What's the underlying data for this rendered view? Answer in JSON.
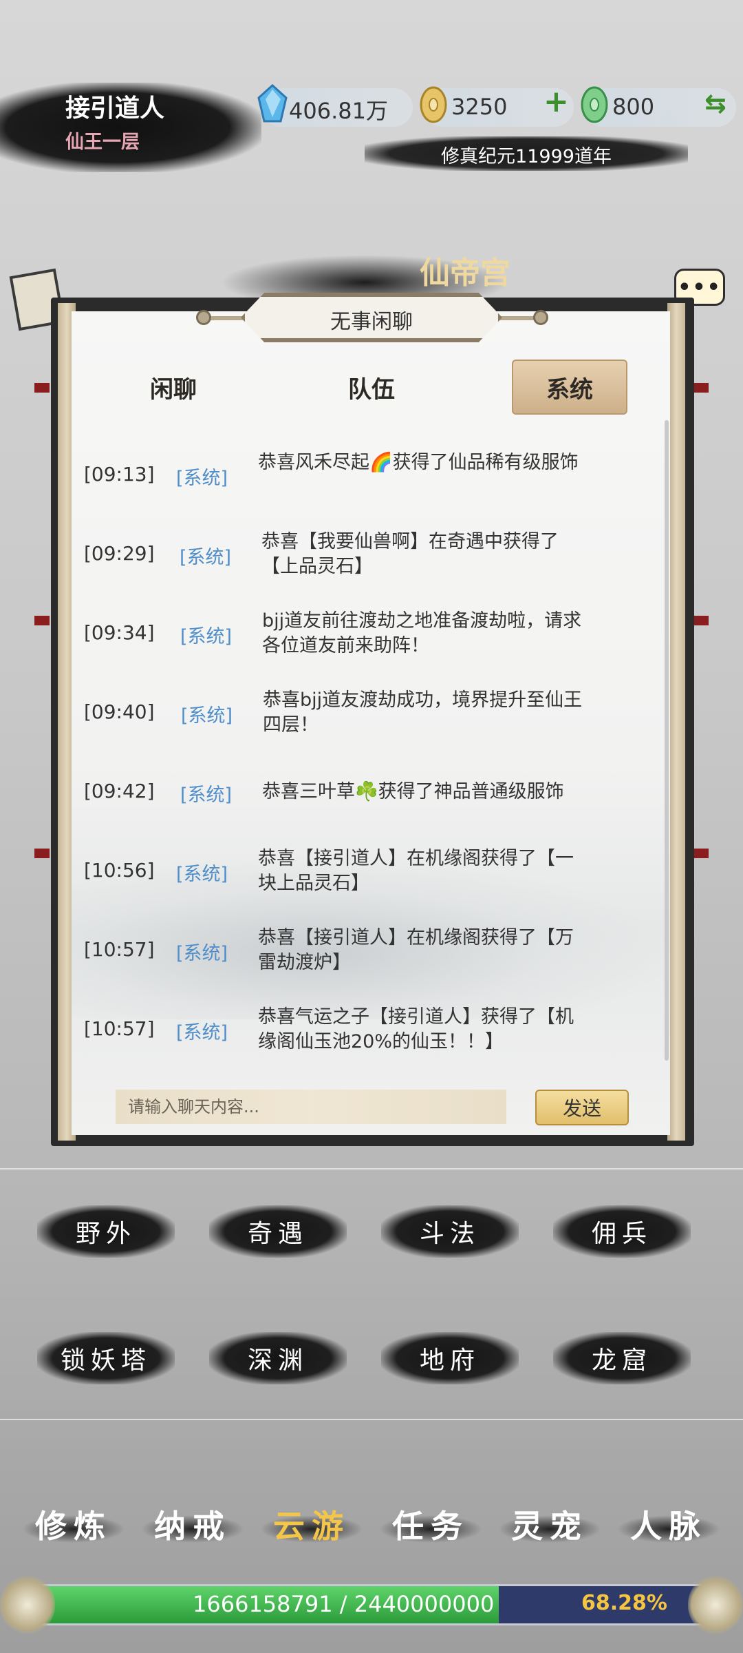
{
  "player": {
    "name": "接引道人",
    "rank": "仙王一层"
  },
  "resources": {
    "spirit_stone": {
      "value": "406.81万",
      "icon": "blue-crystal-icon"
    },
    "gold": {
      "value": "3250",
      "icon": "gold-coin-icon"
    },
    "jade": {
      "value": "800",
      "icon": "jade-coin-icon"
    },
    "plus_label": "+",
    "swap_label": "⇆"
  },
  "era": "修真纪元11999道年",
  "background": {
    "banner": "仙帝宫"
  },
  "dialog": {
    "title": "无事闲聊",
    "more_label": "•••",
    "tabs": [
      {
        "label": "闲聊",
        "active": false
      },
      {
        "label": "队伍",
        "active": false
      },
      {
        "label": "系统",
        "active": true
      }
    ],
    "messages": [
      {
        "time": "[09:13]",
        "tag": "[系统]",
        "text": "恭喜风禾尽起🌈获得了仙品稀有级服饰"
      },
      {
        "time": "[09:29]",
        "tag": "[系统]",
        "text": "恭喜【我要仙兽啊】在奇遇中获得了【上品灵石】"
      },
      {
        "time": "[09:34]",
        "tag": "[系统]",
        "text": "bjj道友前往渡劫之地准备渡劫啦，请求各位道友前来助阵！"
      },
      {
        "time": "[09:40]",
        "tag": "[系统]",
        "text": "恭喜bjj道友渡劫成功，境界提升至仙王四层！"
      },
      {
        "time": "[09:42]",
        "tag": "[系统]",
        "text": "恭喜三叶草☘️获得了神品普通级服饰"
      },
      {
        "time": "[10:56]",
        "tag": "[系统]",
        "text": "恭喜【接引道人】在机缘阁获得了【一块上品灵石】"
      },
      {
        "time": "[10:57]",
        "tag": "[系统]",
        "text": "恭喜【接引道人】在机缘阁获得了【万雷劫渡炉】"
      },
      {
        "time": "[10:57]",
        "tag": "[系统]",
        "text": "恭喜气运之子【接引道人】获得了【机缘阁仙玉池20%的仙玉！！】"
      }
    ],
    "input_placeholder": "请输入聊天内容...",
    "send_label": "发送"
  },
  "actions": [
    "野外",
    "奇遇",
    "斗法",
    "佣兵",
    "锁妖塔",
    "深渊",
    "地府",
    "龙窟"
  ],
  "nav": [
    {
      "label": "修炼",
      "active": false
    },
    {
      "label": "纳戒",
      "active": false
    },
    {
      "label": "云游",
      "active": true
    },
    {
      "label": "任务",
      "active": false
    },
    {
      "label": "灵宠",
      "active": false
    },
    {
      "label": "人脉",
      "active": false
    }
  ],
  "exp": {
    "text": "1666158791 / 2440000000",
    "percent_label": "68.28%",
    "fraction": 0.6828
  },
  "colors": {
    "accent_gold": "#f3c64a",
    "system_tag": "#4f8ec9",
    "exp_green": "#2b9b3a"
  }
}
